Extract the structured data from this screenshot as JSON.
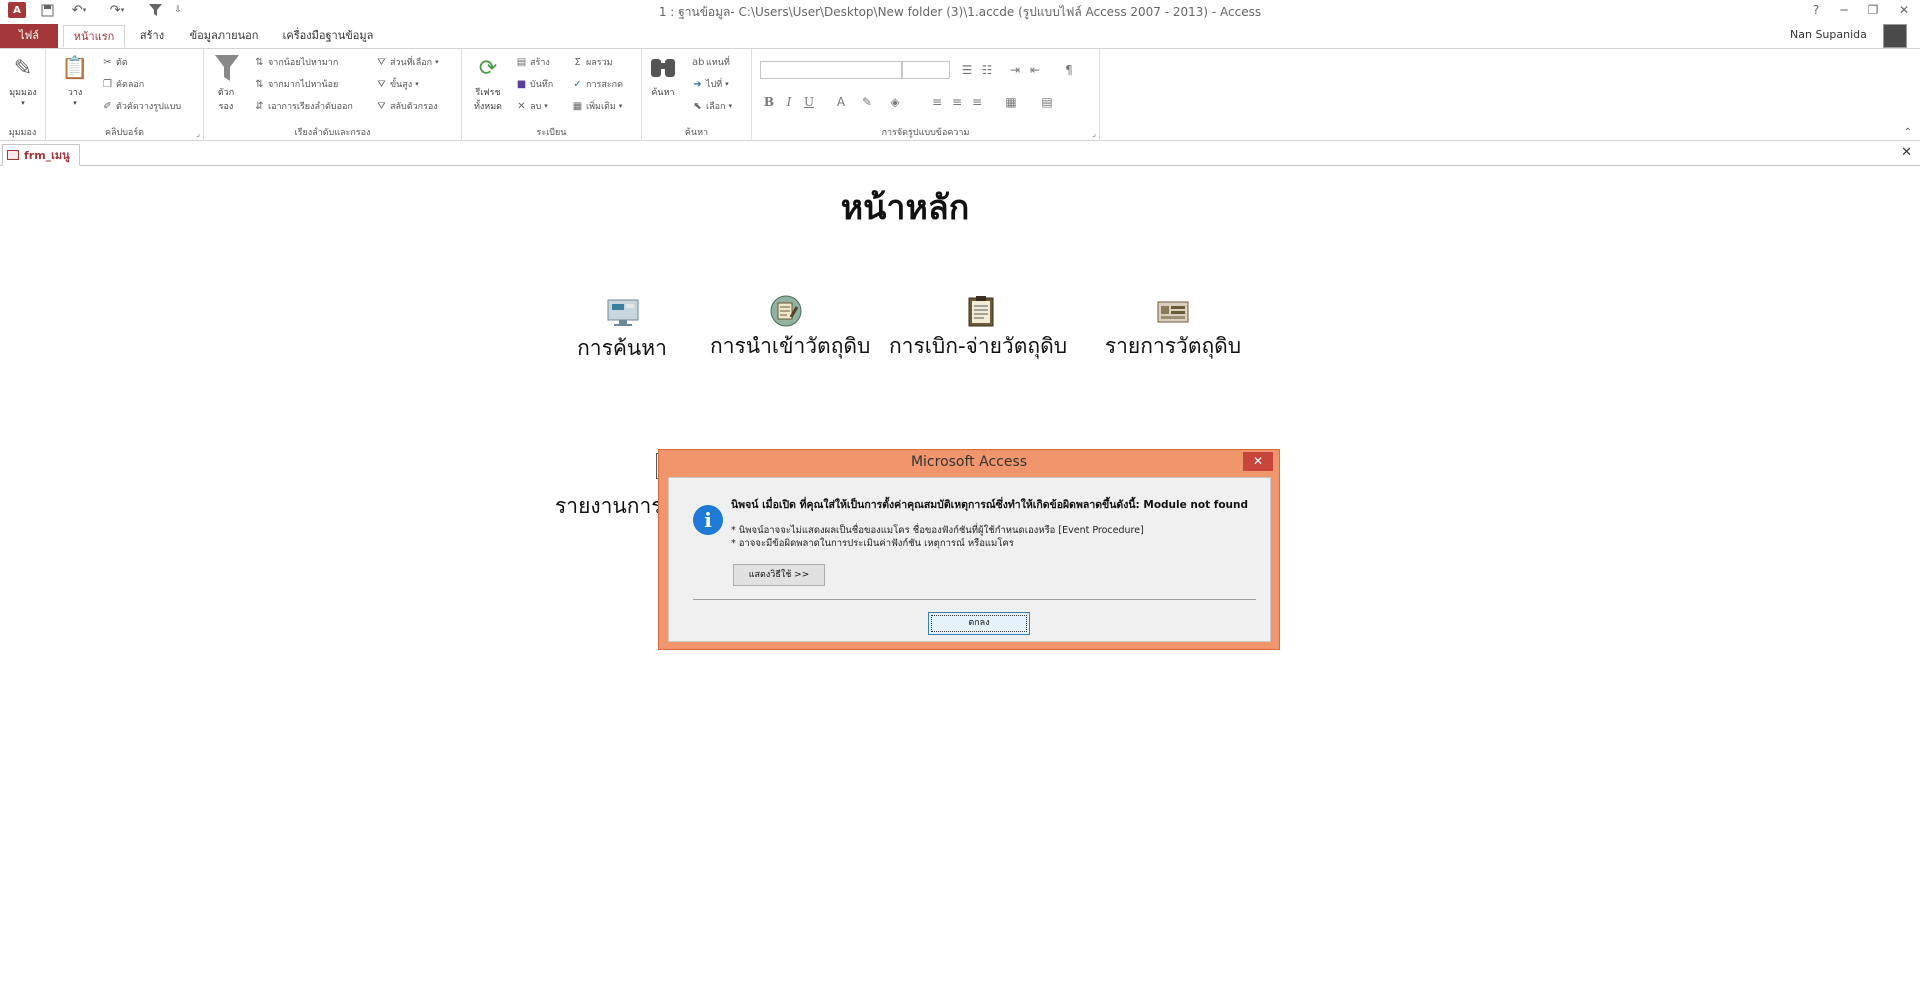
{
  "window": {
    "title": "1 : ฐานข้อมูล- C:\\Users\\User\\Desktop\\New folder (3)\\1.accde (รูปแบบไฟล์ Access 2007 - 2013) - Access",
    "help_label": "?",
    "minimize_label": "─",
    "restore_label": "❐",
    "close_label": "✕"
  },
  "quick_access": {
    "app_logo": "A",
    "save_icon": "save-icon",
    "undo_icon": "undo-icon",
    "redo_icon": "redo-icon",
    "filter_icon": "filter-icon"
  },
  "ribbon_tabs": [
    {
      "label": "ไฟล์"
    },
    {
      "label": "หน้าแรก"
    },
    {
      "label": "สร้าง"
    },
    {
      "label": "ข้อมูลภายนอก"
    },
    {
      "label": "เครื่องมือฐานข้อมูล"
    }
  ],
  "user": {
    "name": "Nan Supanida"
  },
  "ribbon": {
    "views": {
      "view_label": "มุมมอง",
      "group": "มุมมอง"
    },
    "clipboard": {
      "paste": "วาง",
      "cut": "ตัด",
      "copy": "คัดลอก",
      "format_painter": "ตัวคัดวางรูปแบบ",
      "group": "คลิปบอร์ด"
    },
    "sort_filter": {
      "filter": "ตัวกรอง",
      "ascending": "จากน้อยไปหามาก",
      "descending": "จากมากไปหาน้อย",
      "remove_sort": "เอาการเรียงลำดับออก",
      "selection": "ส่วนที่เลือก",
      "advanced": "ขั้นสูง",
      "toggle_filter": "สลับตัวกรอง",
      "group": "เรียงลำดับและกรอง"
    },
    "records": {
      "refresh_all": "รีเฟรชทั้งหมด",
      "new": "สร้าง",
      "save": "บันทึก",
      "delete": "ลบ",
      "totals": "ผลรวม",
      "spelling": "การสะกด",
      "more": "เพิ่มเติม",
      "group": "ระเบียน"
    },
    "find": {
      "find": "ค้นหา",
      "replace": "แทนที่",
      "goto": "ไปที่",
      "select": "เลือก",
      "group": "ค้นหา"
    },
    "text_format": {
      "bold": "B",
      "italic": "I",
      "underline": "U",
      "group": "การจัดรูปแบบข้อความ"
    }
  },
  "document_tab": {
    "label": "frm_เมนู"
  },
  "form": {
    "title": "หน้าหลัก",
    "nav": [
      {
        "label": "การค้นหา",
        "icon": "search-computer-icon"
      },
      {
        "label": "การนำเข้าวัตถุดิบ",
        "icon": "import-materials-icon"
      },
      {
        "label": "การเบิก-จ่ายวัตถุดิบ",
        "icon": "clipboard-icon"
      },
      {
        "label": "รายการวัตถุดิบ",
        "icon": "materials-list-icon"
      }
    ],
    "report_label": "รายงานการเ"
  },
  "dialog": {
    "title": "Microsoft Access",
    "close_label": "✕",
    "message": "นิพจน์ เมื่อเปิด ที่คุณใส่ให้เป็นการตั้งค่าคุณสมบัติเหตุการณ์ซึ่งทำให้เกิดข้อผิดพลาดขึ้นดังนี้: Module not found",
    "line1": "* นิพจน์อาจจะไม่แสดงผลเป็นชื่อของแมโคร ชื่อของฟังก์ชันที่ผู้ใช้กำหนดเองหรือ [Event Procedure]",
    "line2": "* อาจจะมีข้อผิดพลาดในการประเมินค่าฟังก์ชัน เหตุการณ์ หรือแมโคร",
    "show_help_label": "แสดงวิธีใช้ >>",
    "ok_label": "ตกลง"
  }
}
